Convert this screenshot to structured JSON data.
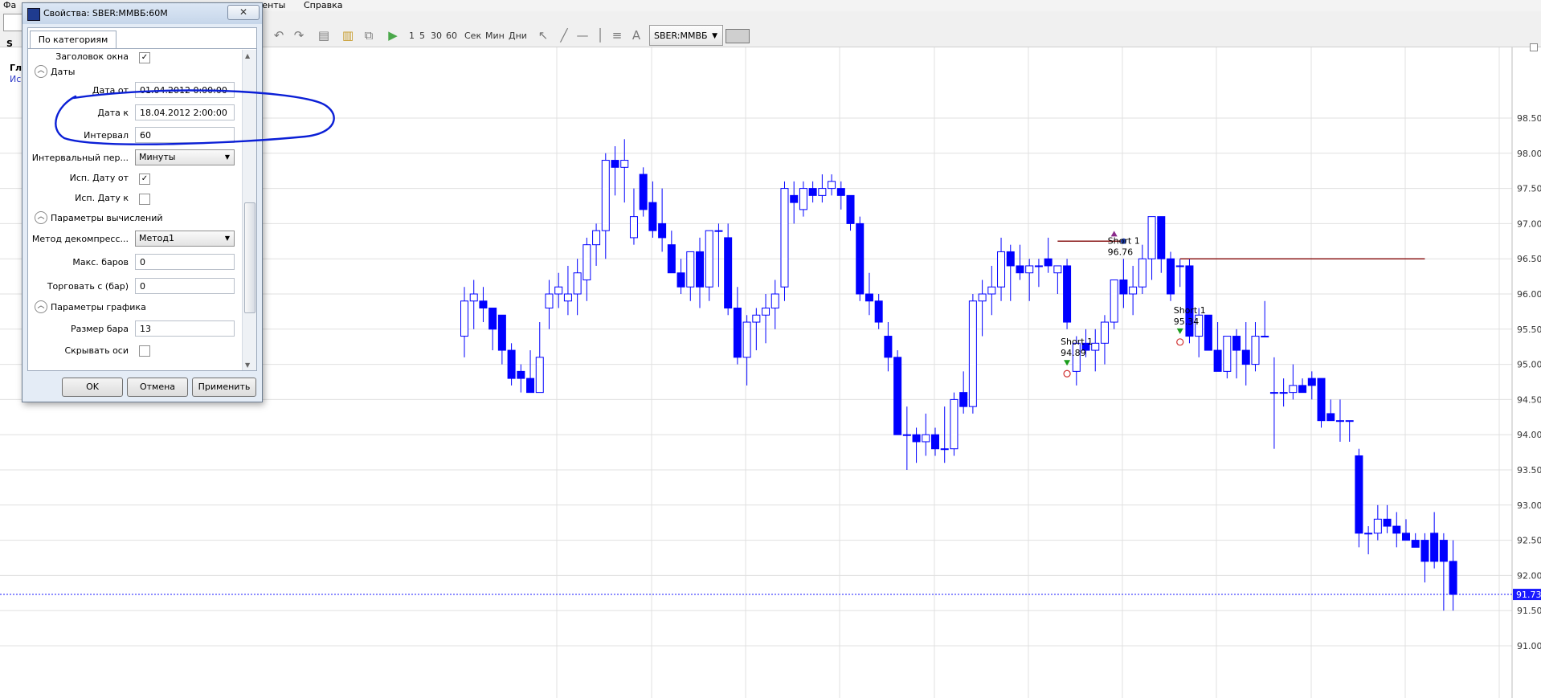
{
  "menu": {
    "file_partial": "Фа",
    "tools_partial": "менты",
    "help": "Справка"
  },
  "toolbar": {
    "intervals": [
      "1",
      "5",
      "30",
      "60"
    ],
    "units": [
      "Сек",
      "Мин",
      "Дни"
    ],
    "symbol": "SBER:MMBБ",
    "tab_partial": "S"
  },
  "left_strip": {
    "line1": "Гл",
    "line2": "Ис"
  },
  "dialog": {
    "title": "Свойства: SBER:MMBБ:60M",
    "close_label": "✕",
    "tab": "По категориям",
    "rows": {
      "window_header": "Заголовок окна",
      "dates_category": "Даты",
      "date_from_label": "Дата от",
      "date_from_value": "01.04.2012 0:00:00",
      "date_to_label": "Дата к",
      "date_to_value": "18.04.2012 2:00:00",
      "interval_label": "Интервал",
      "interval_value": "60",
      "interval_period_label": "Интервальный пер...",
      "interval_period_value": "Минуты",
      "use_date_from_label": "Исп. Дату от",
      "use_date_to_label": "Исп. Дату к",
      "calc_category": "Параметры вычислений",
      "decompress_label": "Метод декомпресс...",
      "decompress_value": "Метод1",
      "max_bars_label": "Макс. баров",
      "max_bars_value": "0",
      "trade_from_label": "Торговать с (бар)",
      "trade_from_value": "0",
      "graph_category": "Параметры графика",
      "bar_size_label": "Размер бара",
      "bar_size_value": "13",
      "hide_axes_label": "Скрывать оси"
    },
    "buttons": {
      "ok": "OK",
      "cancel": "Отмена",
      "apply": "Применить"
    }
  },
  "chart_data": {
    "type": "candlestick",
    "symbol": "SBER:MMBБ",
    "interval": "60 min",
    "y_ticks": [
      "98.50",
      "98.00",
      "97.50",
      "97.00",
      "96.50",
      "96.00",
      "95.50",
      "95.00",
      "94.50",
      "94.00",
      "93.50",
      "93.00",
      "92.50",
      "92.00",
      "91.50",
      "91.00"
    ],
    "ylim": [
      90.75,
      98.6
    ],
    "last_price": "91.73",
    "colors": {
      "up": "#ffffff",
      "down": "#0000ff",
      "wick": "#0000ff",
      "grid": "#e0e0e0",
      "level": "#8b1a1a",
      "last": "#1a1aff"
    },
    "candles": [
      [
        95.4,
        96.1,
        95.1,
        95.9
      ],
      [
        95.9,
        96.2,
        95.5,
        96.0
      ],
      [
        95.9,
        96.1,
        95.6,
        95.8
      ],
      [
        95.8,
        95.8,
        95.2,
        95.5
      ],
      [
        95.7,
        95.7,
        95.0,
        95.2
      ],
      [
        95.2,
        95.3,
        94.7,
        94.8
      ],
      [
        94.9,
        95.0,
        94.6,
        94.8
      ],
      [
        94.8,
        95.2,
        94.6,
        94.6
      ],
      [
        94.6,
        95.6,
        94.6,
        95.1
      ],
      [
        95.8,
        96.2,
        95.5,
        96.0
      ],
      [
        96.0,
        96.3,
        95.8,
        96.1
      ],
      [
        95.9,
        96.4,
        95.7,
        96.0
      ],
      [
        96.0,
        96.5,
        95.7,
        96.3
      ],
      [
        96.2,
        96.8,
        95.9,
        96.7
      ],
      [
        96.7,
        97.0,
        96.4,
        96.9
      ],
      [
        96.9,
        98.0,
        96.5,
        97.9
      ],
      [
        97.9,
        98.1,
        97.4,
        97.8
      ],
      [
        97.8,
        98.2,
        97.3,
        97.9
      ],
      [
        96.8,
        97.5,
        96.7,
        97.1
      ],
      [
        97.7,
        97.8,
        97.1,
        97.2
      ],
      [
        97.3,
        97.6,
        96.8,
        96.9
      ],
      [
        97.0,
        97.5,
        96.6,
        96.8
      ],
      [
        96.7,
        96.9,
        96.3,
        96.3
      ],
      [
        96.3,
        96.5,
        96.0,
        96.1
      ],
      [
        96.1,
        96.6,
        95.9,
        96.6
      ],
      [
        96.6,
        96.8,
        95.8,
        96.1
      ],
      [
        96.1,
        96.9,
        95.9,
        96.9
      ],
      [
        96.9,
        97.0,
        96.1,
        96.9
      ],
      [
        96.8,
        97.0,
        95.7,
        95.8
      ],
      [
        95.8,
        96.1,
        95.0,
        95.1
      ],
      [
        95.1,
        95.7,
        94.7,
        95.6
      ],
      [
        95.6,
        95.8,
        95.2,
        95.7
      ],
      [
        95.7,
        96.0,
        95.3,
        95.8
      ],
      [
        95.8,
        96.2,
        95.5,
        96.0
      ],
      [
        96.1,
        97.6,
        95.9,
        97.5
      ],
      [
        97.4,
        97.6,
        97.0,
        97.3
      ],
      [
        97.2,
        97.6,
        97.1,
        97.5
      ],
      [
        97.5,
        97.6,
        97.3,
        97.4
      ],
      [
        97.4,
        97.7,
        97.3,
        97.5
      ],
      [
        97.5,
        97.7,
        97.4,
        97.6
      ],
      [
        97.5,
        97.6,
        97.2,
        97.4
      ],
      [
        97.4,
        97.4,
        96.9,
        97.0
      ],
      [
        97.0,
        97.1,
        95.9,
        96.0
      ],
      [
        96.0,
        96.3,
        95.7,
        95.9
      ],
      [
        95.9,
        96.0,
        95.5,
        95.6
      ],
      [
        95.4,
        95.6,
        94.9,
        95.1
      ],
      [
        95.1,
        95.2,
        94.0,
        94.0
      ],
      [
        94.0,
        94.4,
        93.5,
        94.0
      ],
      [
        94.0,
        94.1,
        93.6,
        93.9
      ],
      [
        93.9,
        94.3,
        93.7,
        94.0
      ],
      [
        94.0,
        94.1,
        93.7,
        93.8
      ],
      [
        93.8,
        94.4,
        93.6,
        93.8
      ],
      [
        93.8,
        94.6,
        93.7,
        94.5
      ],
      [
        94.6,
        94.9,
        94.3,
        94.4
      ],
      [
        94.4,
        96.0,
        94.3,
        95.9
      ],
      [
        95.9,
        96.2,
        95.4,
        96.0
      ],
      [
        96.0,
        96.4,
        95.7,
        96.1
      ],
      [
        96.1,
        96.8,
        95.9,
        96.6
      ],
      [
        96.6,
        96.7,
        95.9,
        96.4
      ],
      [
        96.4,
        96.7,
        96.2,
        96.3
      ],
      [
        96.3,
        96.5,
        95.9,
        96.4
      ],
      [
        96.4,
        96.5,
        96.1,
        96.4
      ],
      [
        96.5,
        96.8,
        96.3,
        96.4
      ],
      [
        96.3,
        96.4,
        96.0,
        96.4
      ],
      [
        96.4,
        96.5,
        95.5,
        95.6
      ],
      [
        94.9,
        95.4,
        94.7,
        95.3
      ],
      [
        95.3,
        95.5,
        95.1,
        95.2
      ],
      [
        95.2,
        95.5,
        94.9,
        95.3
      ],
      [
        95.3,
        95.7,
        95.0,
        95.6
      ],
      [
        95.6,
        96.2,
        95.5,
        96.2
      ],
      [
        96.2,
        96.5,
        95.8,
        96.0
      ],
      [
        96.0,
        96.4,
        95.7,
        96.1
      ],
      [
        96.1,
        96.7,
        96.0,
        96.5
      ],
      [
        96.5,
        97.1,
        96.2,
        97.1
      ],
      [
        97.1,
        97.1,
        96.3,
        96.5
      ],
      [
        96.5,
        96.6,
        95.9,
        96.0
      ],
      [
        96.4,
        96.5,
        96.1,
        96.4
      ],
      [
        96.4,
        96.5,
        95.3,
        95.4
      ],
      [
        95.4,
        95.8,
        95.1,
        95.7
      ],
      [
        95.7,
        95.7,
        95.2,
        95.2
      ],
      [
        95.2,
        95.6,
        94.9,
        94.9
      ],
      [
        94.9,
        95.4,
        94.8,
        95.4
      ],
      [
        95.4,
        95.5,
        94.8,
        95.2
      ],
      [
        95.2,
        95.6,
        94.7,
        95.0
      ],
      [
        95.0,
        95.6,
        94.9,
        95.4
      ],
      [
        95.4,
        95.9,
        95.4,
        95.4
      ],
      [
        94.6,
        95.1,
        93.8,
        94.6
      ],
      [
        94.6,
        94.8,
        94.4,
        94.6
      ],
      [
        94.6,
        95.0,
        94.5,
        94.7
      ],
      [
        94.7,
        94.8,
        94.6,
        94.6
      ],
      [
        94.8,
        94.9,
        94.5,
        94.7
      ],
      [
        94.8,
        94.8,
        94.1,
        94.2
      ],
      [
        94.3,
        94.5,
        94.2,
        94.2
      ],
      [
        94.2,
        94.5,
        93.9,
        94.2
      ],
      [
        94.2,
        94.2,
        93.9,
        94.2
      ],
      [
        93.7,
        93.8,
        92.4,
        92.6
      ],
      [
        92.6,
        92.7,
        92.3,
        92.6
      ],
      [
        92.6,
        93.0,
        92.5,
        92.8
      ],
      [
        92.8,
        93.0,
        92.6,
        92.7
      ],
      [
        92.7,
        92.9,
        92.4,
        92.6
      ],
      [
        92.6,
        92.8,
        92.5,
        92.5
      ],
      [
        92.5,
        92.6,
        92.4,
        92.4
      ],
      [
        92.5,
        92.6,
        91.9,
        92.2
      ],
      [
        92.6,
        92.9,
        92.1,
        92.2
      ],
      [
        92.5,
        92.6,
        91.5,
        92.2
      ],
      [
        92.2,
        92.5,
        91.5,
        91.73
      ]
    ],
    "levels": [
      {
        "price": 96.75,
        "from": 63,
        "to": 70
      },
      {
        "price": 96.5,
        "from": 76,
        "to": 102
      }
    ],
    "signals": [
      {
        "label": "Short 1",
        "price": "94.89",
        "index": 64,
        "arrow": "down"
      },
      {
        "label": "Short 1",
        "price": "96.76",
        "index": 69,
        "arrow": "up"
      },
      {
        "label": "Short 1",
        "price": "95.34",
        "index": 76,
        "arrow": "down"
      }
    ]
  }
}
